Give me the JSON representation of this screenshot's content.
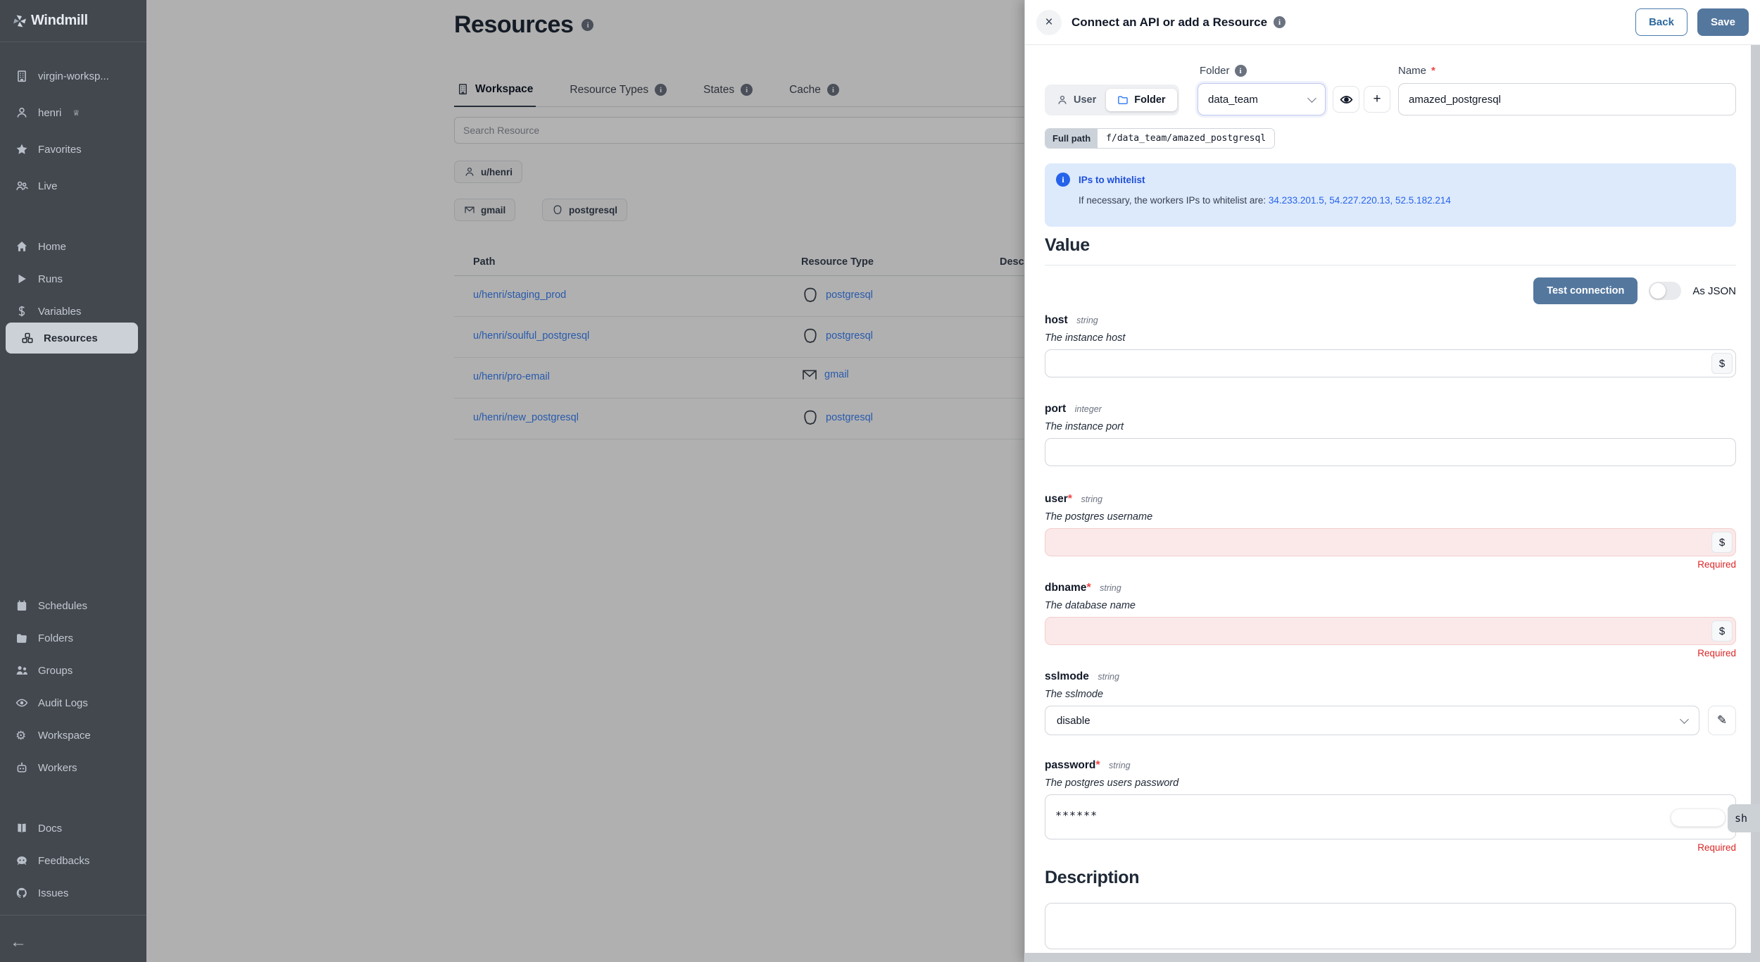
{
  "sidebar": {
    "logo_text": "Windmill",
    "workspace": "virgin-worksp...",
    "user": "henri",
    "favorites": "Favorites",
    "live": "Live",
    "home": "Home",
    "runs": "Runs",
    "variables": "Variables",
    "resources": "Resources",
    "schedules": "Schedules",
    "folders": "Folders",
    "groups": "Groups",
    "audit_logs": "Audit Logs",
    "workspace_settings": "Workspace",
    "workers": "Workers",
    "docs": "Docs",
    "feedbacks": "Feedbacks",
    "issues": "Issues"
  },
  "main": {
    "title": "Resources",
    "tabs": [
      {
        "label": "Workspace"
      },
      {
        "label": "Resource Types"
      },
      {
        "label": "States"
      },
      {
        "label": "Cache"
      }
    ],
    "search_placeholder": "Search Resource",
    "owner_chip": "u/henri",
    "type_chips": [
      "gmail",
      "postgresql"
    ],
    "table": {
      "headers": [
        "Path",
        "Resource Type",
        "Description"
      ],
      "rows": [
        {
          "path": "u/henri/staging_prod",
          "type": "postgresql"
        },
        {
          "path": "u/henri/soulful_postgresql",
          "type": "postgresql"
        },
        {
          "path": "u/henri/pro-email",
          "type": "gmail"
        },
        {
          "path": "u/henri/new_postgresql",
          "type": "postgresql"
        }
      ]
    }
  },
  "drawer": {
    "title": "Connect an API or add a Resource",
    "back_label": "Back",
    "save_label": "Save",
    "owner_toggle": {
      "user": "User",
      "folder": "Folder"
    },
    "folder_label": "Folder",
    "folder_value": "data_team",
    "name_label": "Name",
    "name_value": "amazed_postgresql",
    "full_path_label": "Full path",
    "full_path_value": "f/data_team/amazed_postgresql",
    "alert": {
      "title": "IPs to whitelist",
      "body": "If necessary, the workers IPs to whitelist are:",
      "ips": "34.233.201.5, 54.227.220.13, 52.5.182.214"
    },
    "value_heading": "Value",
    "test_connection_label": "Test connection",
    "as_json_label": "As JSON",
    "required_label": "Required",
    "required_mark": "*",
    "fields": {
      "host": {
        "name": "host",
        "type": "string",
        "description": "The instance host"
      },
      "port": {
        "name": "port",
        "type": "integer",
        "description": "The instance port"
      },
      "user": {
        "name": "user",
        "type": "string",
        "description": "The postgres username"
      },
      "dbname": {
        "name": "dbname",
        "type": "string",
        "description": "The database name"
      },
      "sslmode": {
        "name": "sslmode",
        "type": "string",
        "description": "The sslmode",
        "value": "disable"
      },
      "password": {
        "name": "password",
        "type": "string",
        "description": "The postgres users password",
        "value": "******"
      }
    },
    "show_tooltip": "sh",
    "description_heading": "Description"
  },
  "icons": {
    "close": "×",
    "info": "i",
    "plus": "+",
    "dollar": "$",
    "pencil": "✎",
    "back_arrow": "←",
    "star": "★",
    "play": "▶",
    "gear": "⚙",
    "crown": "♕"
  },
  "colors": {
    "accent": "#54779e",
    "link": "#3b82f6",
    "required": "#dc2626",
    "alert_bg": "#ddeafc",
    "alert_title": "#1d4fd8",
    "sidebar_bg": "#43484f"
  }
}
